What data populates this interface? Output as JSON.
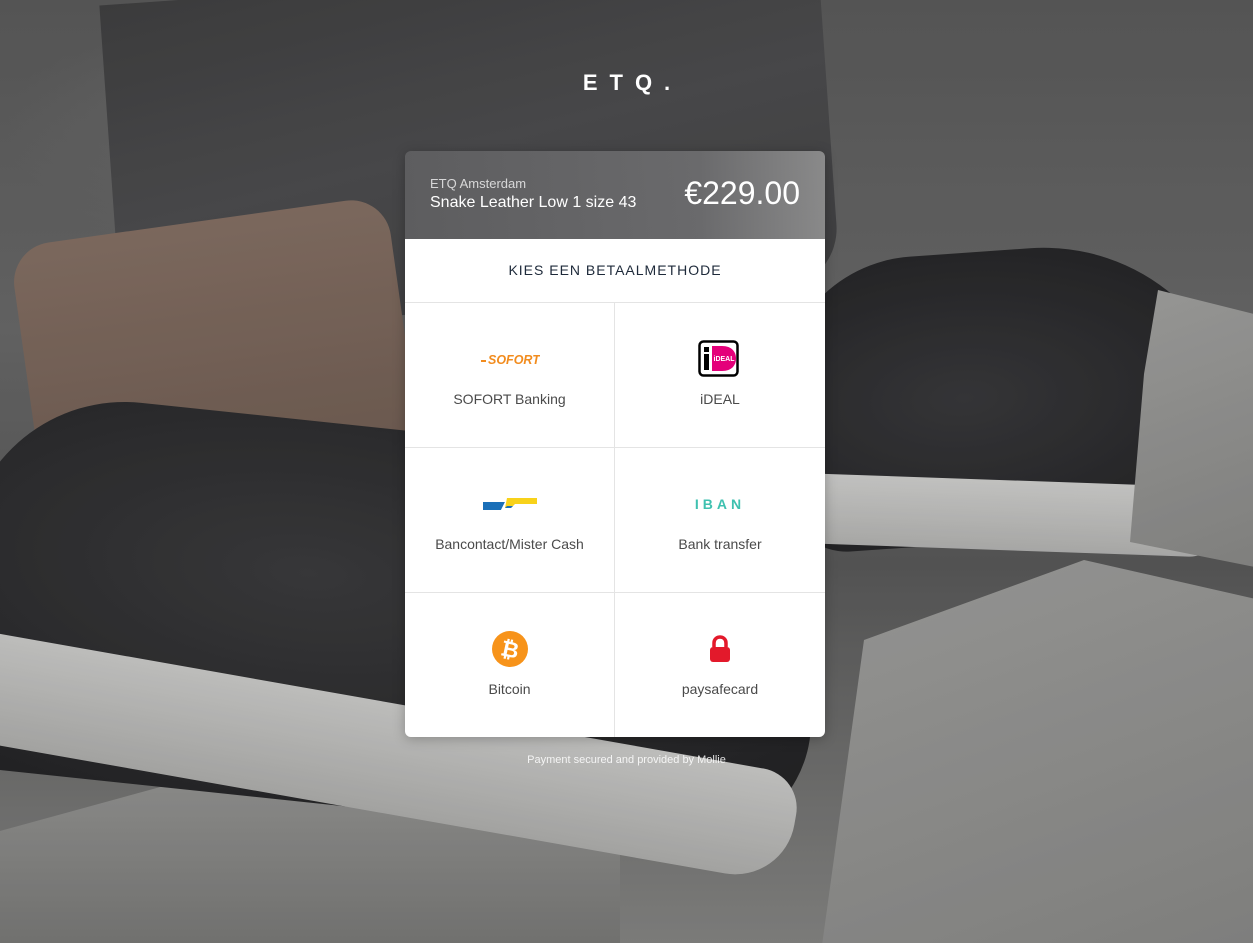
{
  "brand": {
    "logo_text": "ETQ."
  },
  "order": {
    "merchant": "ETQ Amsterdam",
    "product": "Snake Leather Low 1 size 43",
    "amount": "€229.00"
  },
  "methods": {
    "title": "KIES EEN BETAALMETHODE",
    "items": [
      {
        "label": "SOFORT Banking",
        "logo_text": "SOFORT",
        "icon": "sofort-icon"
      },
      {
        "label": "iDEAL",
        "logo_text": "iDEAL",
        "icon": "ideal-icon"
      },
      {
        "label": "Bancontact/Mister Cash",
        "icon": "bancontact-icon"
      },
      {
        "label": "Bank transfer",
        "logo_text": "IBAN",
        "icon": "iban-icon"
      },
      {
        "label": "Bitcoin",
        "icon": "bitcoin-icon"
      },
      {
        "label": "paysafecard",
        "icon": "paysafecard-icon"
      }
    ]
  },
  "footer": {
    "text": "Payment secured and provided by Mollie"
  },
  "colors": {
    "sofort": "#f28c1e",
    "ideal_pink": "#e4007a",
    "bancontact_blue": "#1a6fb8",
    "bancontact_yellow": "#f8d21a",
    "iban": "#3fc1b0",
    "bitcoin": "#f7931a",
    "paysafecard": "#e3192b"
  }
}
